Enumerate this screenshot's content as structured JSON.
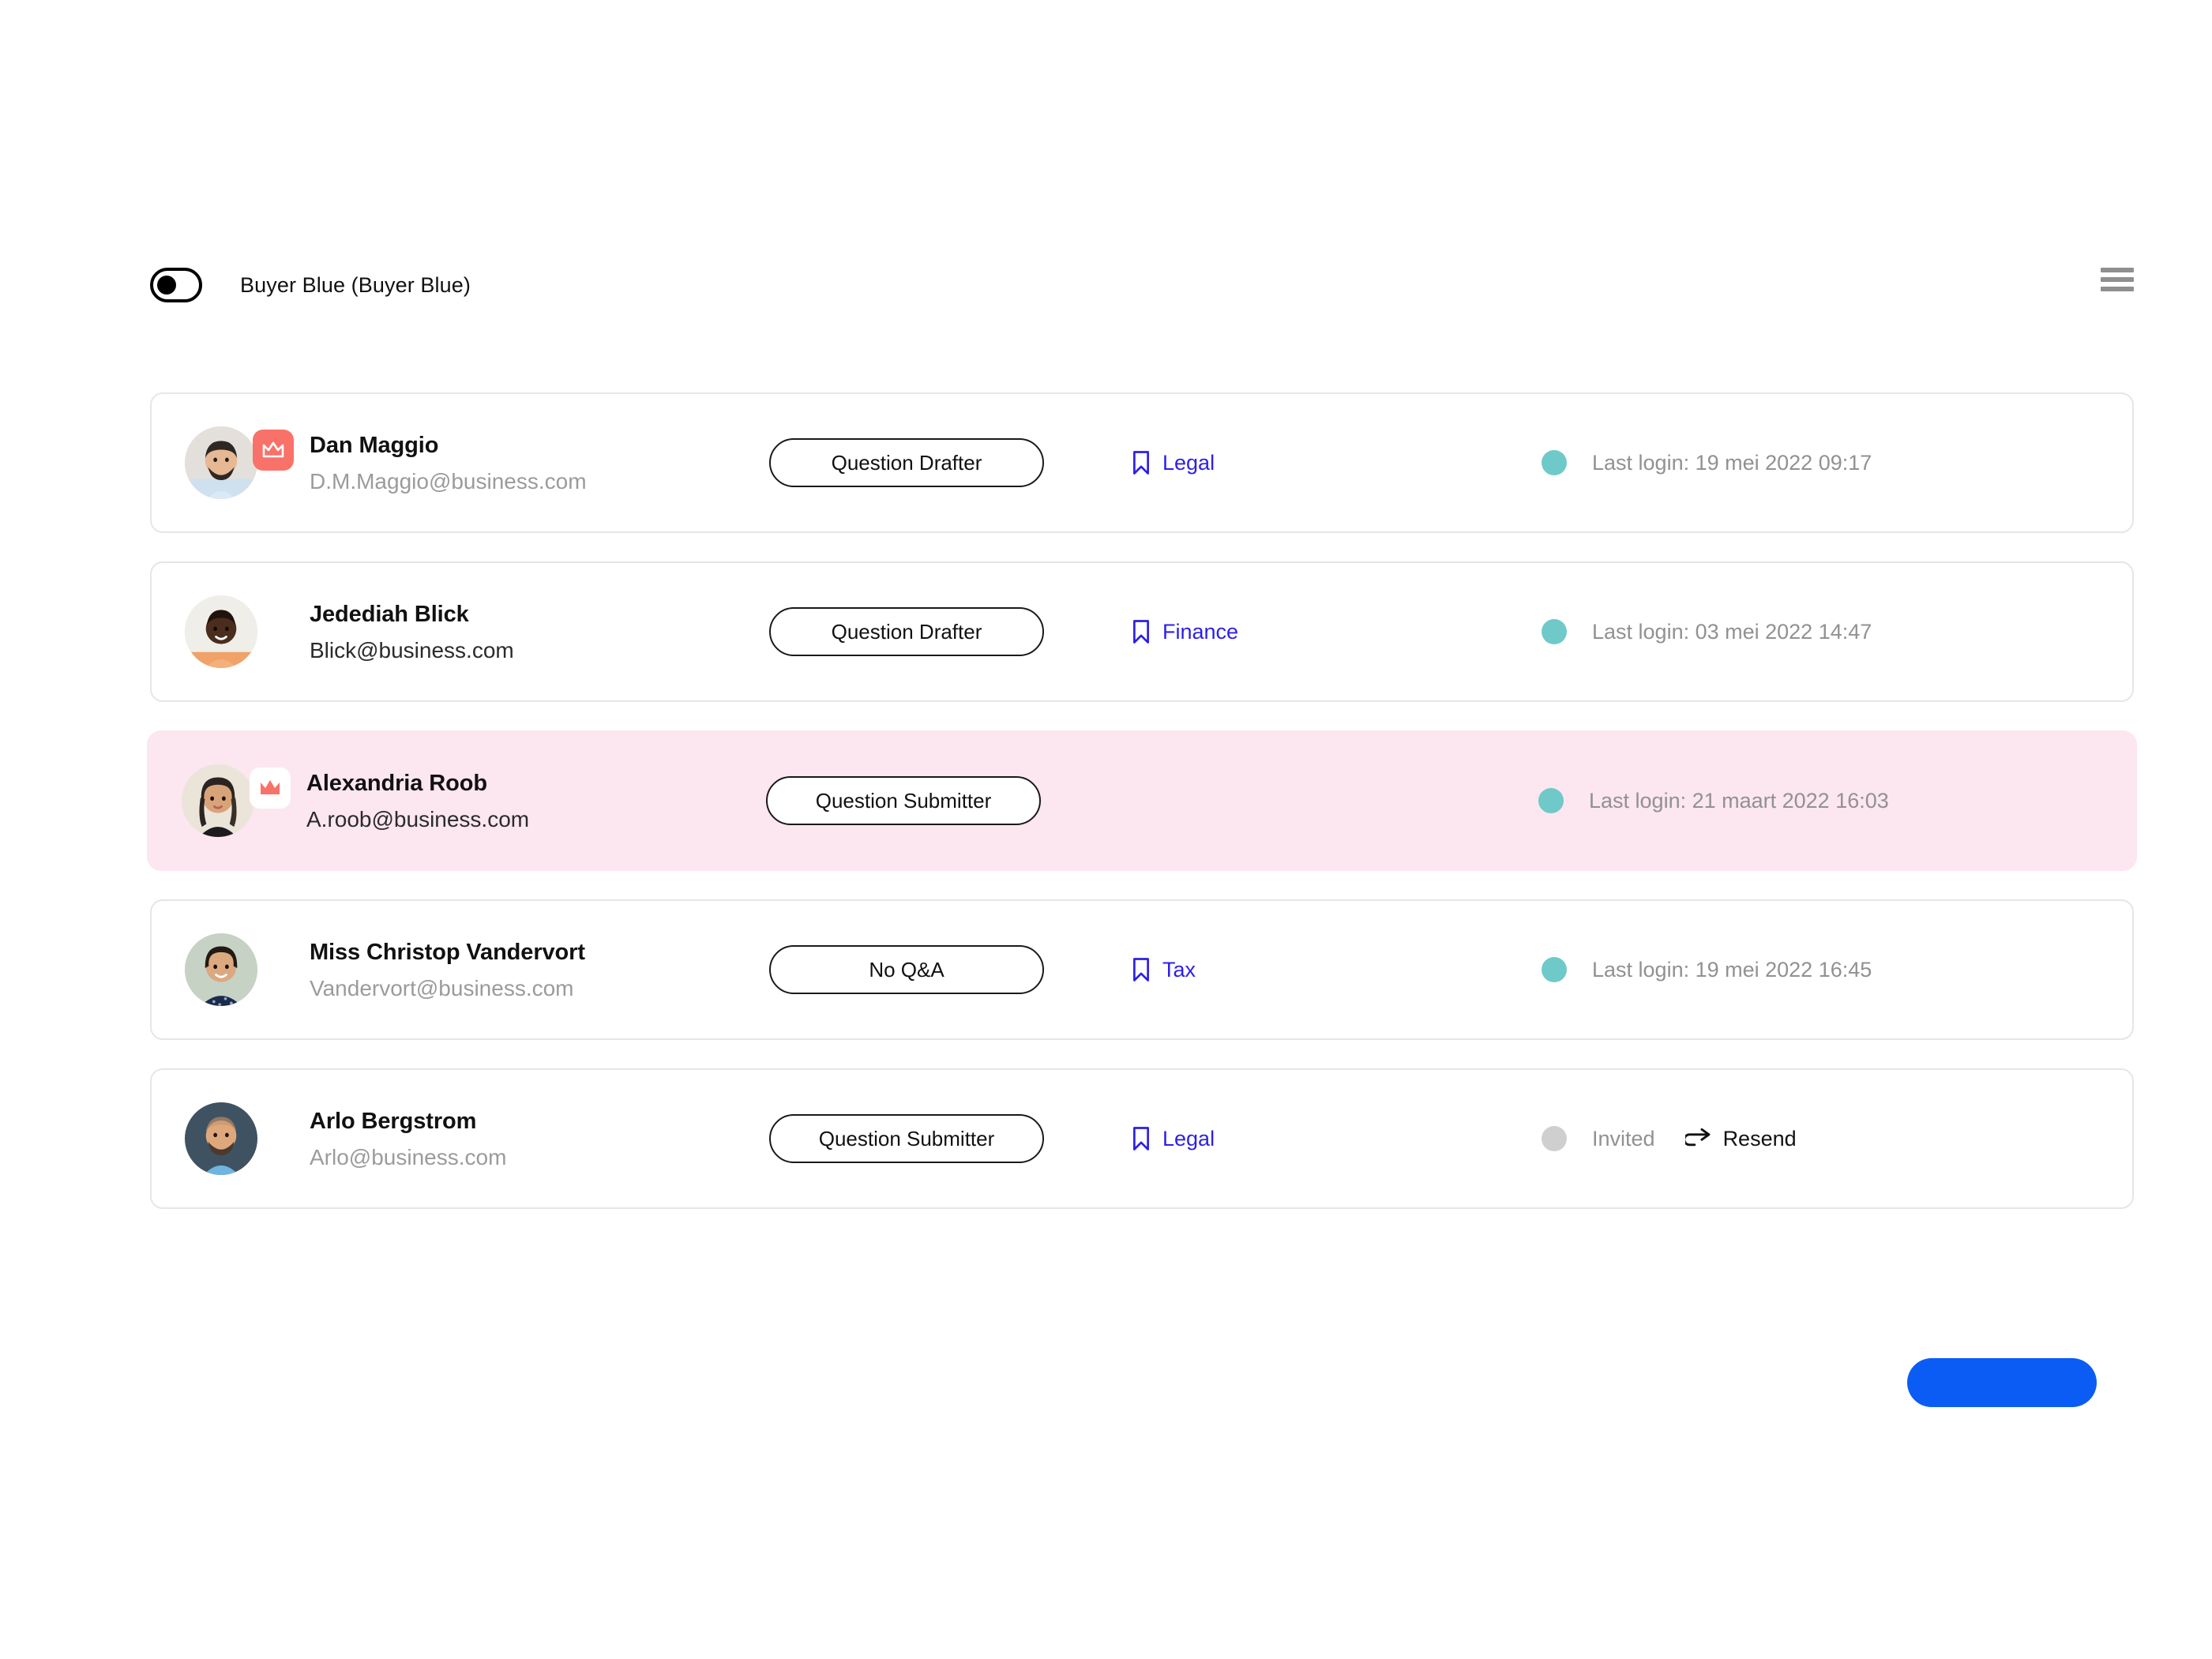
{
  "header": {
    "toggle": {
      "state": "off",
      "name": "buyer-blue-toggle"
    },
    "title": "Buyer Blue (Buyer Blue)",
    "menu_icon": "hamburger-menu-icon"
  },
  "colors": {
    "accent_blue": "#0b5cf5",
    "tag_blue": "#2d1fe8",
    "badge_coral": "#f9726a",
    "status_active": "#6fc9c9",
    "status_invited": "#cfcfcf",
    "row_highlight": "#fce6f0",
    "muted_text": "#9b9b9b"
  },
  "users": [
    {
      "name": "Dan Maggio",
      "email": "D.M.Maggio@business.com",
      "email_style": "muted",
      "badge": "crown-filled",
      "role": "Question Drafter",
      "tag": "Legal",
      "has_tag": true,
      "status": "active",
      "status_text": "Last login: 19 mei 2022 09:17",
      "resend": null,
      "highlighted": false
    },
    {
      "name": "Jedediah Blick",
      "email": "Blick@business.com",
      "email_style": "dark",
      "badge": null,
      "role": "Question Drafter",
      "tag": "Finance",
      "has_tag": true,
      "status": "active",
      "status_text": "Last login: 03 mei 2022 14:47",
      "resend": null,
      "highlighted": false
    },
    {
      "name": "Alexandria Roob",
      "email": "A.roob@business.com",
      "email_style": "dark",
      "badge": "crown-inverted",
      "role": "Question Submitter",
      "tag": "",
      "has_tag": false,
      "status": "active",
      "status_text": "Last login: 21 maart 2022 16:03",
      "resend": null,
      "highlighted": true
    },
    {
      "name": "Miss Christop Vandervort",
      "email": "Vandervort@business.com",
      "email_style": "muted",
      "badge": null,
      "role": "No Q&A",
      "tag": "Tax",
      "has_tag": true,
      "status": "active",
      "status_text": "Last login: 19 mei 2022 16:45",
      "resend": null,
      "highlighted": false
    },
    {
      "name": "Arlo Bergstrom",
      "email": "Arlo@business.com",
      "email_style": "muted",
      "badge": null,
      "role": "Question Submitter",
      "tag": "Legal",
      "has_tag": true,
      "status": "invited",
      "status_text": "Invited",
      "resend": "Resend",
      "highlighted": false
    }
  ],
  "footer": {
    "primary_button_label": "",
    "primary_button_name": "primary-action-button"
  }
}
